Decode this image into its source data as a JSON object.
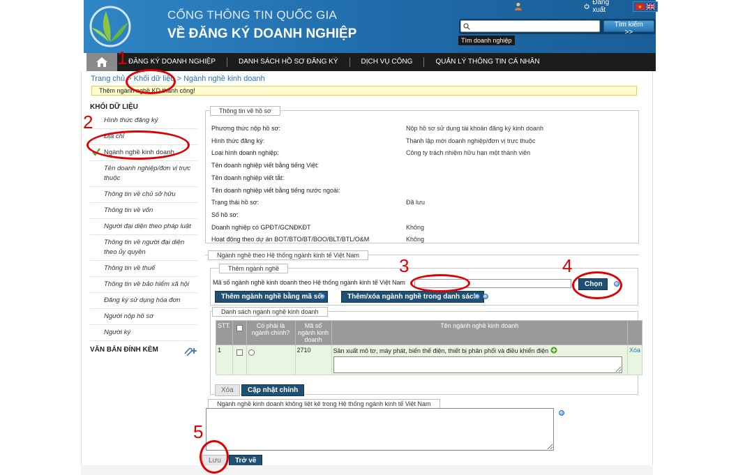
{
  "header": {
    "title_line1": "CỔNG THÔNG TIN QUỐC GIA",
    "title_line2": "VỀ ĐĂNG KÝ DOANH NGHIỆP",
    "logout_label": "Đăng xuất",
    "search_placeholder": "",
    "search_button": "Tìm kiếm >>",
    "search_hint": "Tìm doanh nghiệp"
  },
  "menu": [
    "ĐĂNG KÝ DOANH NGHIỆP",
    "DANH SÁCH HỒ SƠ ĐĂNG KÝ",
    "DỊCH VỤ CÔNG",
    "QUẢN LÝ THÔNG TIN CÁ NHÂN"
  ],
  "breadcrumb": {
    "home": "Trang chủ",
    "sep": " > ",
    "section": "Khối dữ liệu",
    "current": "Ngành nghề kinh doanh"
  },
  "success_message": "Thêm ngành nghề KD thành công!",
  "sidebar": {
    "header": "KHỐI DỮ LIỆU",
    "items": [
      "Hình thức đăng ký",
      "Địa chỉ",
      "Ngành nghề kinh doanh",
      "Tên doanh nghiệp/đơn vị trực thuộc",
      "Thông tin về chủ sở hữu",
      "Thông tin về vốn",
      "Người đại diện theo pháp luật",
      "Thông tin về người đại diện theo ủy quyền",
      "Thông tin về thuế",
      "Thông tin về bảo hiểm xã hội",
      "Đăng ký sử dụng hóa đơn",
      "Người nộp hồ sơ",
      "Người ký"
    ],
    "attach_header": "VĂN BẢN ĐÍNH KÈM"
  },
  "info": {
    "legend": "Thông tin về hồ sơ",
    "rows": [
      {
        "label": "Phương thức nộp hồ sơ:",
        "value": "Nộp hồ sơ sử dụng tài khoản đăng ký kinh doanh"
      },
      {
        "label": "Hình thức đăng ký:",
        "value": "Thành lập mới doanh nghiệp/đơn vị trực thuộc"
      },
      {
        "label": "Loại hình doanh nghiệp:",
        "value": "Công ty trách nhiệm hữu hạn một thành viên"
      },
      {
        "label": "Tên doanh nghiệp viết bằng tiếng Việt:",
        "value": ""
      },
      {
        "label": "Tên doanh nghiệp viết tắt:",
        "value": ""
      },
      {
        "label": "Tên doanh nghiệp viết bằng tiếng nước ngoài:",
        "value": ""
      },
      {
        "label": "Trạng thái hồ sơ:",
        "value": "Đã lưu"
      },
      {
        "label": "Số hồ sơ:",
        "value": ""
      },
      {
        "label": "Doanh nghiệp có GPĐT/GCNĐKĐT",
        "value": "Không"
      },
      {
        "label": "Hoạt động theo dự án BOT/BTO/BT/BOO/BLT/BTL/O&M",
        "value": "Không"
      }
    ]
  },
  "nganh_nghe": {
    "legend": "Ngành nghề theo Hệ thống ngành kinh tế Việt Nam",
    "add_legend": "Thêm ngành nghề",
    "code_label": "Mã số ngành nghề kinh doanh theo Hệ thống ngành kinh tế Việt Nam",
    "choose_button": "Chọn",
    "add_by_code_button": "Thêm ngành nghề bằng mã số",
    "add_remove_button": "Thêm/xóa ngành nghề trong danh sách",
    "list_legend": "Danh sách ngành nghề kinh doanh",
    "table": {
      "headers": [
        "STT.",
        "",
        "Có phải là ngành chính?",
        "Mã số ngành kinh doanh",
        "Tên ngành nghề kinh doanh",
        ""
      ],
      "rows": [
        {
          "stt": "1",
          "code": "2710",
          "name": "Sản xuất mô tơ, máy phát, biến thế điện, thiết bị phân phối và điều khiển điện",
          "action": "Xóa"
        }
      ]
    },
    "delete_button": "Xóa",
    "update_main_button": "Cập nhật chính"
  },
  "other": {
    "legend": "Ngành nghề kinh doanh không liệt kê trong Hệ thống ngành kinh tế Việt Nam",
    "save_button": "Lưu",
    "back_button": "Trở về"
  },
  "annotations": [
    "1",
    "2",
    "3",
    "4",
    "5"
  ],
  "colors": {
    "banner": "#1f6aa8",
    "menubar": "#1c1c1c",
    "button_dark_blue": "#1f4f73",
    "annotation_red": "#e00000",
    "row_green": "#e9f5e0"
  }
}
